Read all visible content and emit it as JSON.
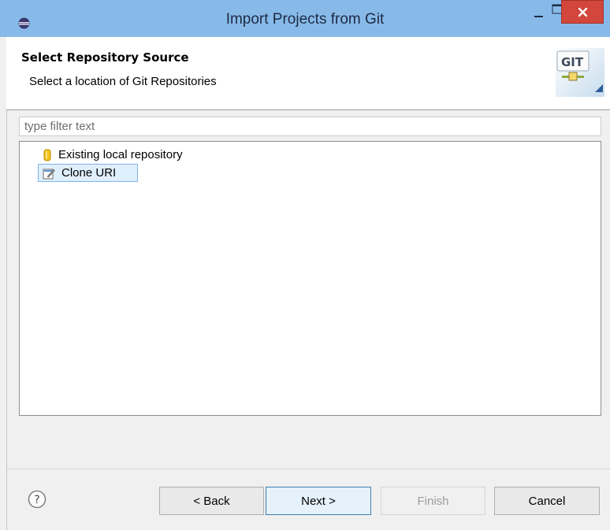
{
  "window": {
    "title": "Import Projects from Git",
    "controls": {
      "minimize": "minimize-icon",
      "maximize": "maximize-icon",
      "close": "close-icon"
    }
  },
  "banner": {
    "title": "Select Repository Source",
    "description": "Select a location of Git Repositories",
    "icon": "git-icon",
    "icon_text": "GIT"
  },
  "filter": {
    "value": "",
    "placeholder": "type filter text"
  },
  "tree": {
    "items": [
      {
        "label": "Existing local repository",
        "icon": "repository-icon",
        "selected": false
      },
      {
        "label": "Clone URI",
        "icon": "clone-uri-icon",
        "selected": true
      }
    ]
  },
  "footer": {
    "help_icon": "help-icon",
    "buttons": {
      "back": "< Back",
      "next": "Next >",
      "finish": "Finish",
      "cancel": "Cancel"
    },
    "finish_enabled": false
  },
  "colors": {
    "titlebar": "#87bae8",
    "close_button": "#d2463c",
    "selection": "#e0effc",
    "selection_border": "#7eb4ea"
  }
}
